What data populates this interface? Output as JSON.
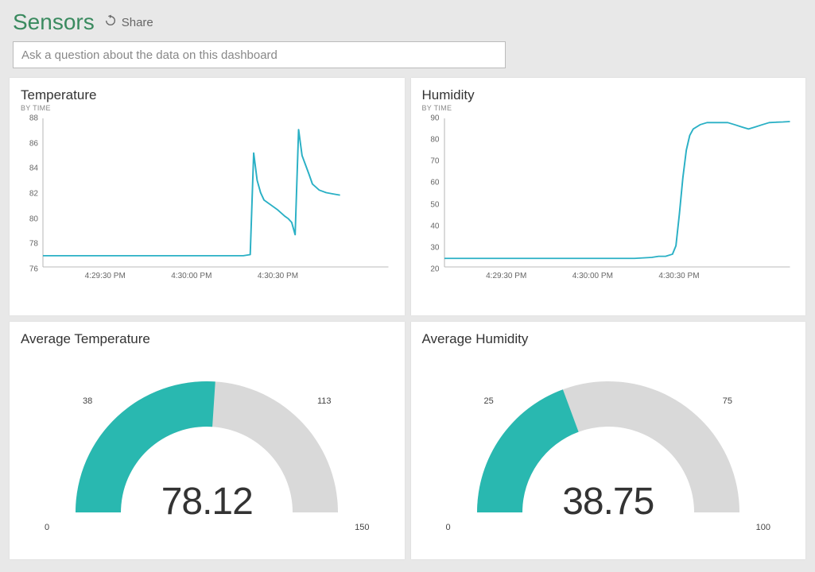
{
  "header": {
    "title": "Sensors",
    "share_label": "Share"
  },
  "qa": {
    "placeholder": "Ask a question about the data on this dashboard"
  },
  "cards": {
    "temp": {
      "title": "Temperature",
      "subtitle": "BY TIME"
    },
    "hum": {
      "title": "Humidity",
      "subtitle": "BY TIME"
    },
    "avg_temp": {
      "title": "Average Temperature"
    },
    "avg_hum": {
      "title": "Average Humidity"
    }
  },
  "gauges": {
    "temp": {
      "min_label": "0",
      "max_label": "150",
      "mid_left_label": "38",
      "mid_right_label": "113",
      "value_text": "78.12",
      "min": 0,
      "max": 150,
      "value": 78.12
    },
    "hum": {
      "min_label": "0",
      "max_label": "100",
      "mid_left_label": "25",
      "mid_right_label": "75",
      "value_text": "38.75",
      "min": 0,
      "max": 100,
      "value": 38.75
    }
  },
  "chart_data": [
    {
      "type": "line",
      "title": "Temperature",
      "subtitle": "BY TIME",
      "ylim": [
        76,
        88
      ],
      "y_ticks": [
        76,
        78,
        80,
        82,
        84,
        86,
        88
      ],
      "x_ticks": [
        "4:29:30 PM",
        "4:30:00 PM",
        "4:30:30 PM"
      ],
      "x": [
        0,
        5,
        10,
        15,
        20,
        25,
        30,
        35,
        40,
        45,
        50,
        55,
        58,
        60,
        61,
        62,
        63,
        64,
        66,
        68,
        70,
        71,
        72,
        73,
        74,
        75,
        77,
        78,
        80,
        82,
        84,
        86
      ],
      "y": [
        76.9,
        76.9,
        76.9,
        76.9,
        76.9,
        76.9,
        76.9,
        76.9,
        76.9,
        76.9,
        76.9,
        76.9,
        76.9,
        77.0,
        85.2,
        83.0,
        82.0,
        81.4,
        81.0,
        80.6,
        80.1,
        79.9,
        79.6,
        78.6,
        87.1,
        85.0,
        83.5,
        82.7,
        82.2,
        82.0,
        81.9,
        81.8
      ],
      "xrange": [
        0,
        100
      ]
    },
    {
      "type": "line",
      "title": "Humidity",
      "subtitle": "BY TIME",
      "ylim": [
        20,
        90
      ],
      "y_ticks": [
        20,
        30,
        40,
        50,
        60,
        70,
        80,
        90
      ],
      "x_ticks": [
        "4:29:30 PM",
        "4:30:00 PM",
        "4:30:30 PM"
      ],
      "x": [
        0,
        5,
        10,
        15,
        20,
        25,
        30,
        35,
        40,
        45,
        50,
        55,
        60,
        62,
        64,
        66,
        67,
        68,
        69,
        70,
        71,
        72,
        74,
        76,
        78,
        80,
        82,
        84,
        86,
        88,
        90,
        92,
        94,
        96,
        98,
        100
      ],
      "y": [
        24,
        24,
        24,
        24,
        24,
        24,
        24,
        24,
        24,
        24,
        24,
        24,
        24.5,
        25,
        25,
        26,
        30,
        45,
        62,
        75,
        82,
        85,
        87,
        88,
        88,
        88,
        88,
        87,
        86,
        85,
        86,
        87,
        88,
        88.2,
        88.3,
        88.5
      ],
      "xrange": [
        0,
        100
      ]
    },
    {
      "type": "gauge",
      "title": "Average Temperature",
      "min": 0,
      "max": 150,
      "value": 78.12,
      "tick_labels": [
        0,
        38,
        113,
        150
      ]
    },
    {
      "type": "gauge",
      "title": "Average Humidity",
      "min": 0,
      "max": 100,
      "value": 38.75,
      "tick_labels": [
        0,
        25,
        75,
        100
      ]
    }
  ],
  "colors": {
    "accent_line": "#2ab0c5",
    "gauge_fill": "#29b8b0",
    "gauge_track": "#d9d9d9",
    "title_green": "#3a8a5f"
  }
}
